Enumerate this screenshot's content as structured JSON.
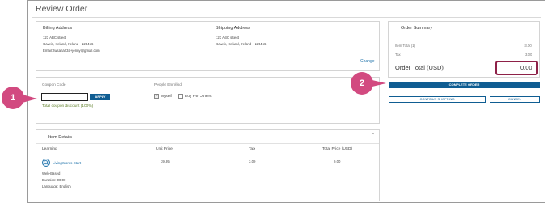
{
  "page": {
    "title": "Review Order"
  },
  "billing": {
    "heading": "Billing Address",
    "street": "123 ABC street",
    "city": "Galwin, Ireland, Ireland - 123456",
    "email": "Email: twsaha234+jenny@gmail.com"
  },
  "shipping": {
    "heading": "Shipping Address",
    "street": "123 ABC street",
    "city": "Galwin, Ireland, Ireland - 123456",
    "change_label": "Change"
  },
  "coupon": {
    "label": "Coupon Code",
    "value": "",
    "apply_label": "APPLY",
    "discount_text": "Total coupon discount (100%)"
  },
  "enrolled": {
    "label": "People Enrolled",
    "myself_label": "Myself",
    "myself_checked": true,
    "others_label": "Buy For Others",
    "others_checked": false
  },
  "items": {
    "heading": "Item Details",
    "columns": [
      "Learning",
      "Unit Price",
      "Tax",
      "Total Price (USD)"
    ],
    "rows": [
      {
        "name": "LivingWorks Start",
        "unit_price": "39.95",
        "tax": "3.00",
        "total": "0.00",
        "type": "Web-Based",
        "duration": "Duration: 00:00",
        "language": "Language: English"
      }
    ]
  },
  "summary": {
    "heading": "Order Summary",
    "item_total_label": "Item Total (1)",
    "item_total_value": "-3.00",
    "tax_label": "Tax",
    "tax_value": "3.00",
    "order_total_label": "Order Total (USD)",
    "order_total_value": "0.00"
  },
  "actions": {
    "complete_label": "COMPLETE ORDER",
    "continue_label": "CONTINUE SHOPPING",
    "cancel_label": "CANCEL"
  },
  "callouts": {
    "one": "1",
    "two": "2"
  },
  "colors": {
    "primary": "#0f5d92",
    "callout": "#d24a80",
    "highlight": "#8e2148",
    "discount": "#5f7f2a"
  }
}
